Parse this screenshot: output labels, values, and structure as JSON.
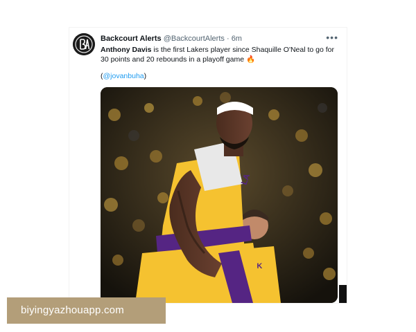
{
  "tweet": {
    "display_name": "Backcourt Alerts",
    "handle": "@BackcourtAlerts",
    "separator": "·",
    "time": "6m",
    "more_icon": "more-horizontal-icon",
    "text_bold": "Anthony Davis",
    "text_rest": " is the first Lakers player since Shaquille O'Neal to go for 30 points and 20 rebounds in a playoff game 🔥",
    "mention_open": "(",
    "mention_handle": "@jovanbuha",
    "mention_close": ")",
    "avatar_logo_letters": "BA"
  },
  "watermark": {
    "text": "biyingyazhouapp.com"
  },
  "colors": {
    "link": "#1d9bf0",
    "watermark_bg": "#b39e79",
    "lakers_gold": "#f5c230",
    "lakers_purple": "#552583"
  }
}
